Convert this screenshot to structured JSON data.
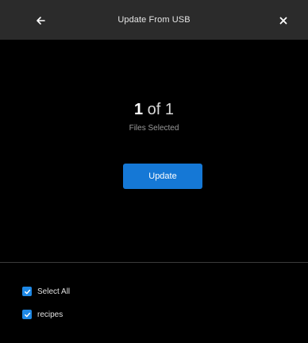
{
  "header": {
    "title": "Update From USB",
    "back_icon": "arrow-left-icon",
    "close_icon": "close-icon"
  },
  "main": {
    "selected_count": "1",
    "selected_of": "of 1",
    "subtitle": "Files Selected",
    "update_label": "Update"
  },
  "list": {
    "items": [
      {
        "label": "Select All",
        "checked": true
      },
      {
        "label": "recipes",
        "checked": true
      }
    ]
  },
  "colors": {
    "header_bg": "#2b2b2b",
    "background": "#000000",
    "accent": "#1578d6",
    "checkbox": "#1e88e5"
  }
}
